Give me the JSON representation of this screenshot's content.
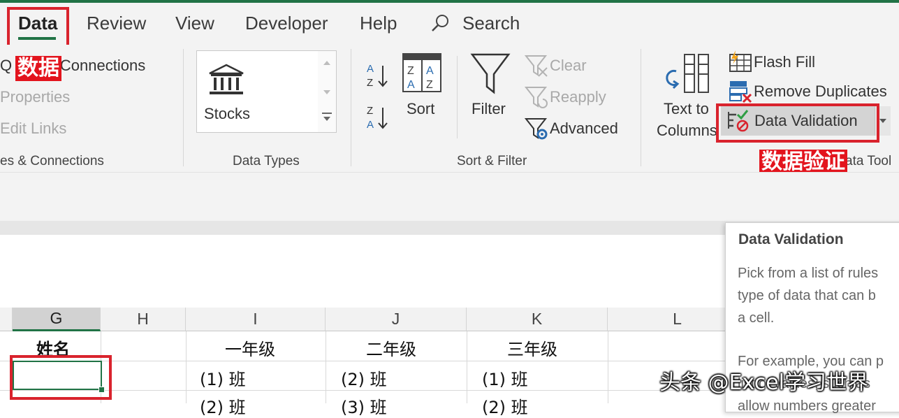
{
  "tabs": {
    "data": "Data",
    "review": "Review",
    "view": "View",
    "developer": "Developer",
    "help": "Help",
    "search": "Search"
  },
  "annotations": {
    "data_cn": "数据",
    "validation_cn": "数据验证"
  },
  "queries": {
    "queries_connections": "Q",
    "queries_connections_rest": "& Connections",
    "properties": "Properties",
    "edit_links": "Edit Links",
    "group_label": "es & Connections"
  },
  "data_types": {
    "stocks": "Stocks",
    "group_label": "Data Types"
  },
  "sort_filter": {
    "sort": "Sort",
    "filter": "Filter",
    "clear": "Clear",
    "reapply": "Reapply",
    "advanced": "Advanced",
    "group_label": "Sort & Filter",
    "az_top": "A",
    "az_bottom": "Z",
    "za_top": "Z",
    "za_bottom": "A"
  },
  "data_tools": {
    "text_to": "Text to",
    "columns": "Columns",
    "flash_fill": "Flash Fill",
    "remove_duplicates": "Remove Duplicates",
    "data_validation": "Data Validation",
    "group_label": "ata Tool"
  },
  "tooltip": {
    "title": "Data Validation",
    "line1": "Pick from a list of rules",
    "line2": "type of data that can b",
    "line3": "a cell.",
    "line4": "For example, you can p",
    "line5": "list of values, such as",
    "line6": "allow numbers greater"
  },
  "columns": [
    "G",
    "H",
    "I",
    "J",
    "K",
    "L"
  ],
  "rows": {
    "header": {
      "g": "姓名",
      "i": "一年级",
      "j": "二年级",
      "k": "三年级"
    },
    "row1": {
      "i": "(1) 班",
      "j": "(2) 班",
      "k": "(1) 班"
    },
    "row2": {
      "i": "(2) 班",
      "j": "(3) 班",
      "k": "(2) 班"
    }
  },
  "watermark": "头条 @Excel学习世界",
  "colors": {
    "excel_green": "#217346",
    "annotation_red": "#e3141d",
    "ribbon_bg": "#f3f3f3"
  }
}
